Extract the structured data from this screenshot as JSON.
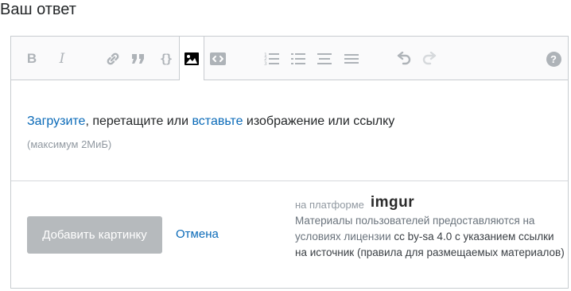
{
  "heading": "Ваш ответ",
  "toolbar": {
    "bold_label": "B",
    "italic_label": "I",
    "code_label": "{}",
    "help_label": "?",
    "buttons": [
      {
        "name": "bold-button",
        "icon": "bold-icon"
      },
      {
        "name": "italic-button",
        "icon": "italic-icon"
      },
      {
        "name": "link-button",
        "icon": "link-icon"
      },
      {
        "name": "blockquote-button",
        "icon": "quote-icon"
      },
      {
        "name": "code-button",
        "icon": "code-braces-icon"
      },
      {
        "name": "image-button",
        "icon": "image-icon",
        "active": true
      },
      {
        "name": "snippet-button",
        "icon": "snippet-icon"
      },
      {
        "name": "ordered-list-button",
        "icon": "ordered-list-icon"
      },
      {
        "name": "unordered-list-button",
        "icon": "unordered-list-icon"
      },
      {
        "name": "heading-button",
        "icon": "heading-icon"
      },
      {
        "name": "horizontal-rule-button",
        "icon": "horizontal-rule-icon"
      },
      {
        "name": "undo-button",
        "icon": "undo-icon"
      },
      {
        "name": "redo-button",
        "icon": "redo-icon"
      },
      {
        "name": "help-button",
        "icon": "help-icon"
      }
    ]
  },
  "upload": {
    "upload_link": "Загрузите",
    "text_middle": ", перетащите или",
    "paste_link": "вставьте",
    "text_end": "изображение или ссылку",
    "hint": "(максимум 2МиБ)"
  },
  "actions": {
    "add_image_label": "Добавить картинку",
    "cancel_label": "Отмена"
  },
  "footer": {
    "powered_by": "на платформе",
    "imgur_logo": "imgur",
    "license_text_1": "Материалы пользователей предоставляются на условиях лицензии",
    "license_link": "cc by-sa 4.0 с указанием ссылки на источник",
    "license_text_2": "(правила для размещаемых материалов)"
  },
  "colors": {
    "link": "#0a6ab8",
    "button_disabled": "#b6babd",
    "icon_muted": "#aeb3b8",
    "imgur_green": "#1bb76e"
  }
}
